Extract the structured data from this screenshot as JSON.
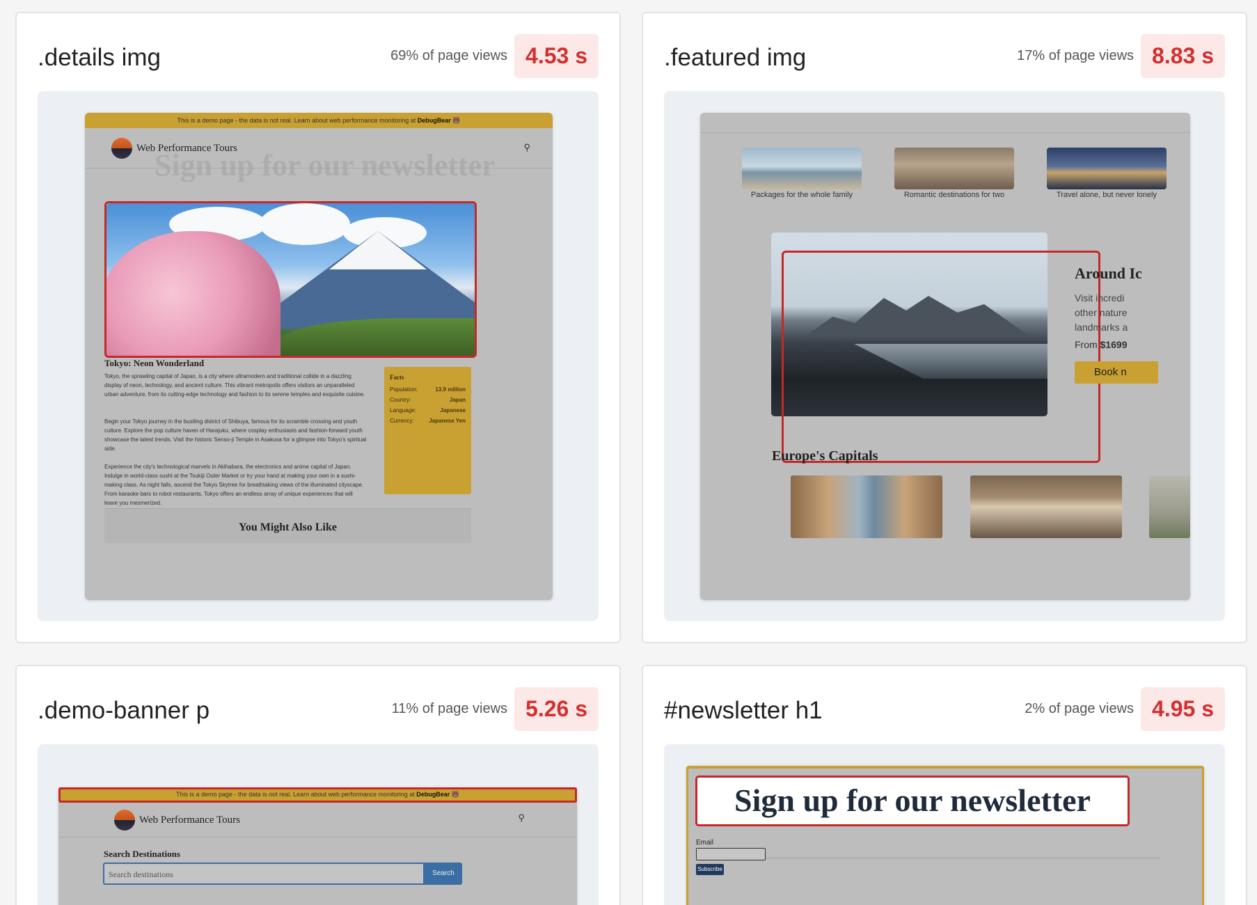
{
  "colors": {
    "badge_bg": "#fde8e8",
    "badge_text": "#d32f2f",
    "highlight": "#c62828",
    "banner": "#c9a032"
  },
  "cards": [
    {
      "selector": ".details img",
      "views": "69% of page views",
      "time": "4.53 s",
      "preview": {
        "banner_text": "This is a demo page - the data is not real. Learn about web performance monitoring at ",
        "banner_link": "DebugBear",
        "brand": "Web Performance Tours",
        "ghost_heading": "Sign up for our newsletter",
        "article_title": "Tokyo: Neon Wonderland",
        "paragraphs": [
          "Tokyo, the sprawling capital of Japan, is a city where ultramodern and traditional collide in a dazzling display of neon, technology, and ancient culture. This vibrant metropolis offers visitors an unparalleled urban adventure, from its cutting-edge technology and fashion to its serene temples and exquisite cuisine.",
          "Begin your Tokyo journey in the bustling district of Shibuya, famous for its scramble crossing and youth culture. Explore the pop culture haven of Harajuku, where cosplay enthusiasts and fashion-forward youth showcase the latest trends. Visit the historic Senso-ji Temple in Asakusa for a glimpse into Tokyo's spiritual side.",
          "Experience the city's technological marvels in Akihabara, the electronics and anime capital of Japan. Indulge in world-class sushi at the Tsukiji Outer Market or try your hand at making your own in a sushi-making class. As night falls, ascend the Tokyo Skytree for breathtaking views of the illuminated cityscape. From karaoke bars to robot restaurants, Tokyo offers an endless array of unique experiences that will leave you mesmerized."
        ],
        "facts_title": "Facts",
        "facts": [
          {
            "label": "Population:",
            "value": "13.9 million"
          },
          {
            "label": "Country:",
            "value": "Japan"
          },
          {
            "label": "Language:",
            "value": "Japanese"
          },
          {
            "label": "Currency:",
            "value": "Japanese Yen"
          }
        ],
        "also_like": "You Might Also Like"
      }
    },
    {
      "selector": ".featured img",
      "views": "17% of page views",
      "time": "8.83 s",
      "preview": {
        "thumbs": [
          "Packages for the whole family",
          "Romantic destinations for two",
          "Travel alone, but never lonely"
        ],
        "feature_title": "Around Ic",
        "feature_text": [
          "Visit incredi",
          "other nature",
          "landmarks a"
        ],
        "price_prefix": "From ",
        "price": "$1699",
        "button": "Book n",
        "section_title": "Europe's Capitals"
      }
    },
    {
      "selector": ".demo-banner p",
      "views": "11% of page views",
      "time": "5.26 s",
      "preview": {
        "banner_text": "This is a demo page - the data is not real. Learn about web performance monitoring at ",
        "banner_link": "DebugBear",
        "brand": "Web Performance Tours",
        "search_heading": "Search Destinations",
        "search_placeholder": "Search destinations",
        "search_button": "Search"
      }
    },
    {
      "selector": "#newsletter h1",
      "views": "2% of page views",
      "time": "4.95 s",
      "preview": {
        "heading": "Sign up for our newsletter",
        "email_label": "Email",
        "subscribe": "Subscribe"
      }
    }
  ]
}
